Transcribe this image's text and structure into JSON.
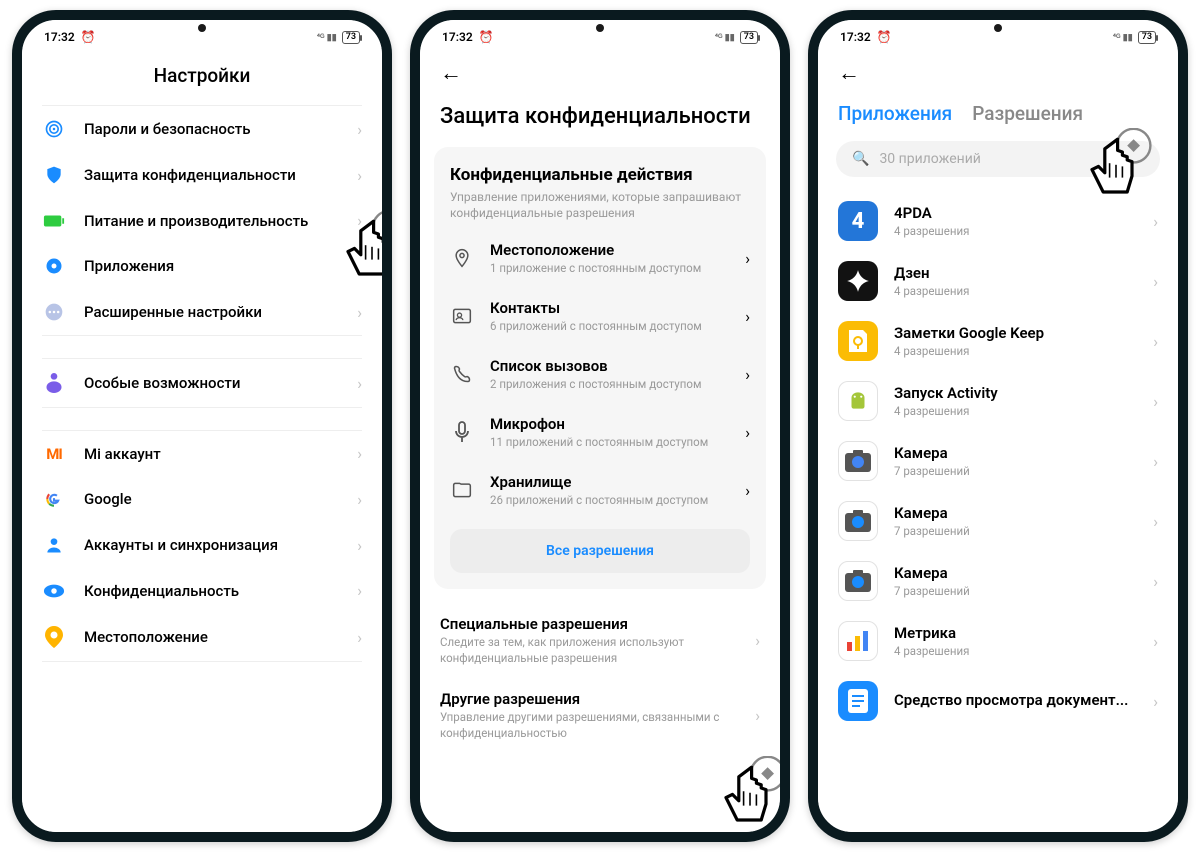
{
  "status": {
    "time": "17:32",
    "battery": "73"
  },
  "screen1": {
    "title": "Настройки",
    "groups": [
      [
        {
          "icon": "fingerprint",
          "color": "#1a8cff",
          "label": "Пароли и безопасность"
        },
        {
          "icon": "shield",
          "color": "#1a8cff",
          "label": "Защита конфиденциальности"
        },
        {
          "icon": "battery",
          "color": "#2ecc40",
          "label": "Питание и производительность"
        },
        {
          "icon": "gear",
          "color": "#1a8cff",
          "label": "Приложения"
        },
        {
          "icon": "dots",
          "color": "#b8c4e6",
          "label": "Расширенные настройки"
        }
      ],
      [
        {
          "icon": "acc",
          "color": "#7a5de8",
          "label": "Особые возможности"
        }
      ],
      [
        {
          "icon": "mi",
          "color": "#ff6900",
          "label": "Mi аккаунт"
        },
        {
          "icon": "google",
          "color": "",
          "label": "Google"
        },
        {
          "icon": "person",
          "color": "#1a8cff",
          "label": "Аккаунты и синхронизация"
        },
        {
          "icon": "eye",
          "color": "#1a8cff",
          "label": "Конфиденциальность"
        },
        {
          "icon": "pin",
          "color": "#ffb400",
          "label": "Местоположение"
        }
      ]
    ]
  },
  "screen2": {
    "title": "Защита конфиденциальности",
    "cardTitle": "Конфиденциальные действия",
    "cardSub": "Управление приложениями, которые запрашивают конфиденциальные разрешения",
    "items": [
      {
        "icon": "loc",
        "t1": "Местоположение",
        "t2": "1 приложение с постоянным доступом"
      },
      {
        "icon": "contacts",
        "t1": "Контакты",
        "t2": "6 приложений с постоянным доступом"
      },
      {
        "icon": "calls",
        "t1": "Список вызовов",
        "t2": "2 приложения с постоянным доступом"
      },
      {
        "icon": "mic",
        "t1": "Микрофон",
        "t2": "11 приложений с постоянным доступом"
      },
      {
        "icon": "storage",
        "t1": "Хранилище",
        "t2": "26 приложений с постоянным доступом"
      }
    ],
    "allBtn": "Все разрешения",
    "blocks": [
      {
        "t": "Специальные разрешения",
        "s": "Следите за тем, как приложения используют конфиденциальные разрешения"
      },
      {
        "t": "Другие разрешения",
        "s": "Управление другими разрешениями, связанными с конфиденциальностью"
      }
    ]
  },
  "screen3": {
    "tabs": {
      "active": "Приложения",
      "inactive": "Разрешения"
    },
    "searchPlaceholder": "30 приложений",
    "apps": [
      {
        "name": "4PDA",
        "sub": "4 разрешения",
        "bg": "#2376d8",
        "glyph": "4"
      },
      {
        "name": "Дзен",
        "sub": "4 разрешения",
        "bg": "#121212",
        "glyph": "✦"
      },
      {
        "name": "Заметки Google Keep",
        "sub": "4 разрешения",
        "bg": "#fbbc04",
        "glyph": "keep"
      },
      {
        "name": "Запуск Activity",
        "sub": "4 разрешения",
        "bg": "#ffffff",
        "glyph": "droid"
      },
      {
        "name": "Камера",
        "sub": "7 разрешений",
        "bg": "#ffffff",
        "glyph": "cam-g"
      },
      {
        "name": "Камера",
        "sub": "7 разрешений",
        "bg": "#ffffff",
        "glyph": "cam-b"
      },
      {
        "name": "Камера",
        "sub": "7 разрешений",
        "bg": "#ffffff",
        "glyph": "cam-b"
      },
      {
        "name": "Метрика",
        "sub": "4 разрешения",
        "bg": "#ffffff",
        "glyph": "bars"
      },
      {
        "name": "Средство просмотра документ...",
        "sub": "",
        "bg": "#1a8cff",
        "glyph": "doc"
      }
    ]
  }
}
